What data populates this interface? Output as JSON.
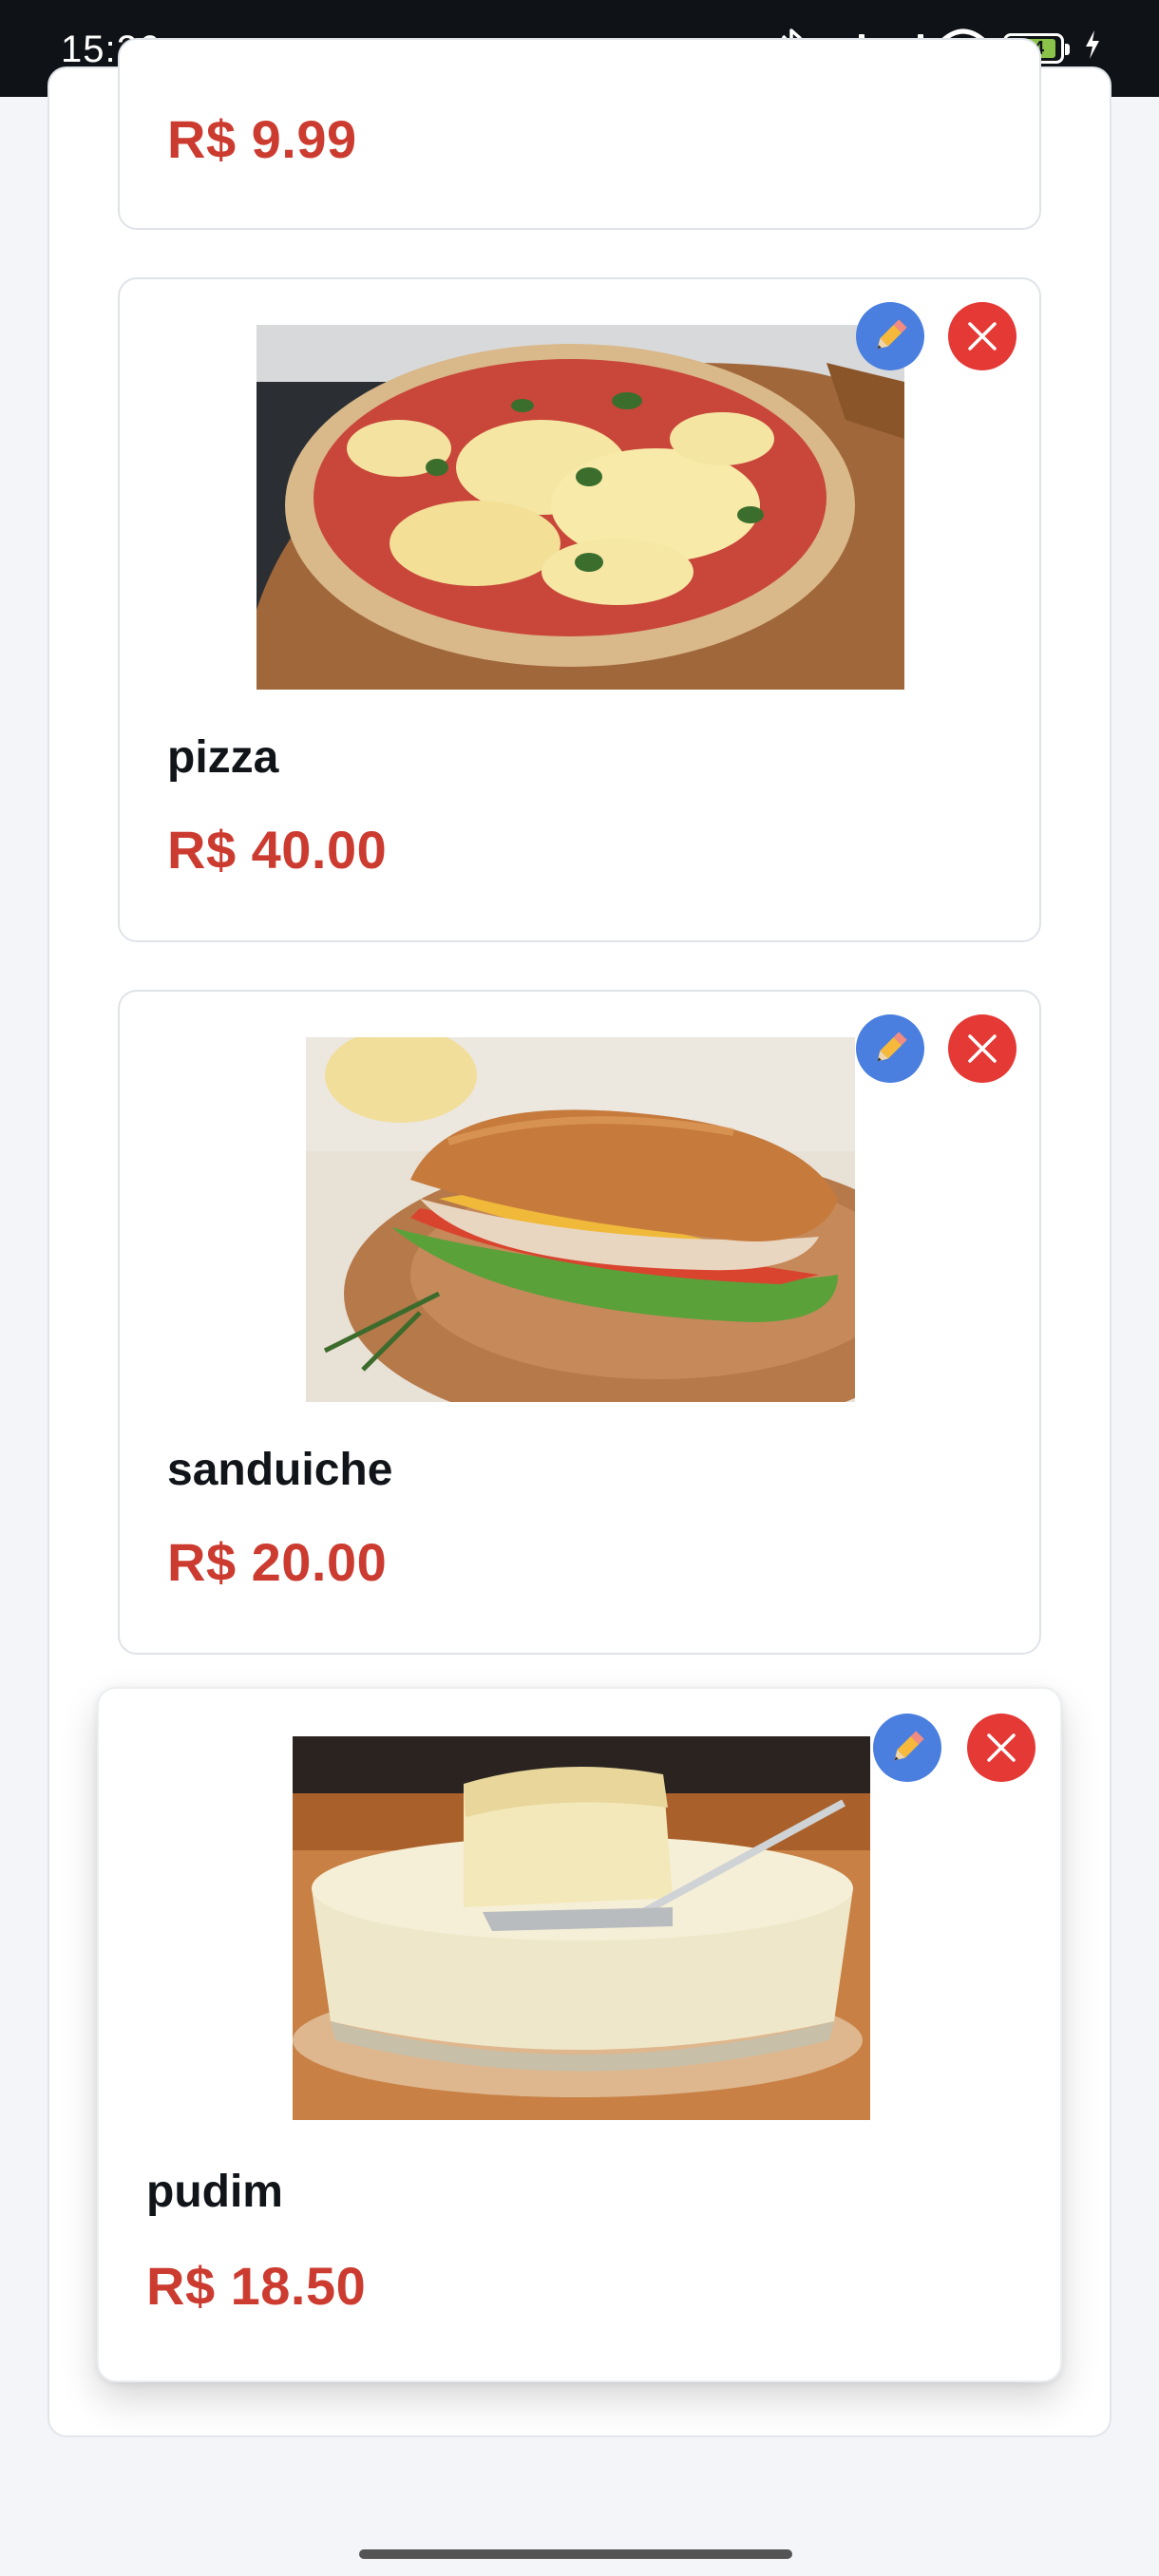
{
  "status_bar": {
    "time": "15:26",
    "battery": "84",
    "icons": [
      "soccer-ball-icon",
      "bluetooth-icon",
      "signal-icon",
      "signal-icon",
      "wifi-icon",
      "battery-icon",
      "charging-icon"
    ]
  },
  "colors": {
    "price": "#cc3b30",
    "edit_button": "#4a7fe0",
    "delete_button": "#e53935",
    "battery_fill": "#8bc34a"
  },
  "products": [
    {
      "name": "",
      "price": "R$ 9.99"
    },
    {
      "name": "pizza",
      "price": "R$ 40.00",
      "image": "pizza-image"
    },
    {
      "name": "sanduiche",
      "price": "R$ 20.00",
      "image": "sandwich-image"
    },
    {
      "name": "pudim",
      "price": "R$ 18.50",
      "image": "pudding-image"
    }
  ],
  "actions": {
    "edit_icon": "pencil-icon",
    "delete_icon": "close-icon"
  }
}
